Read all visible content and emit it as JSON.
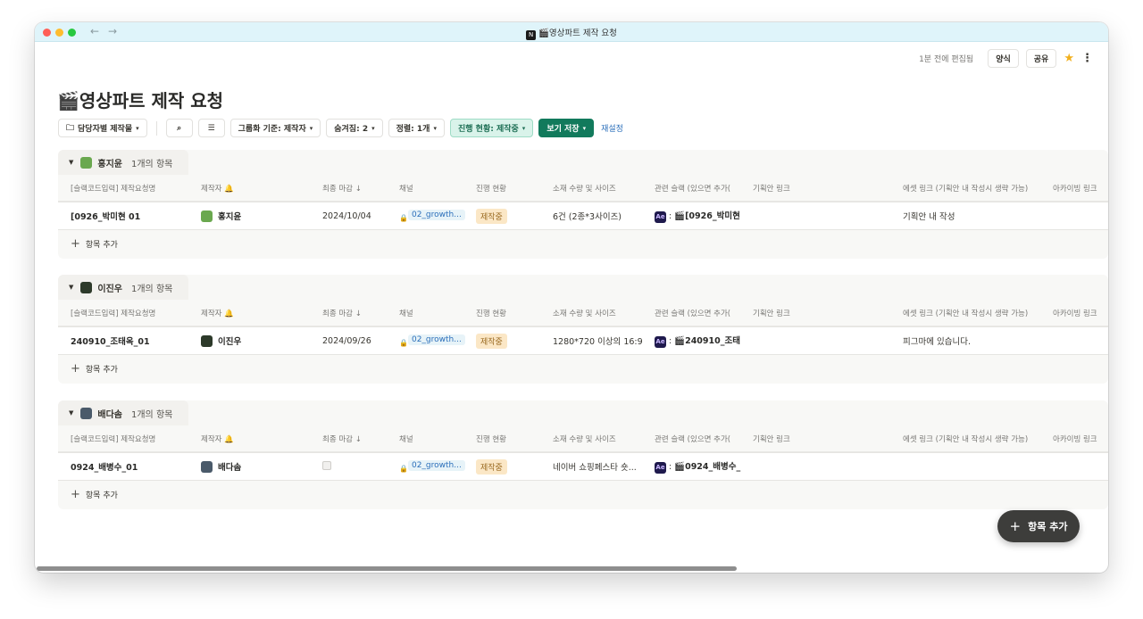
{
  "window": {
    "title": "🎬영상파트 제작 요청",
    "app_icon": "N"
  },
  "topbar": {
    "edited": "1분 전에 편집됨",
    "template_label": "양식",
    "share_label": "공유"
  },
  "page": {
    "title": "🎬영상파트 제작 요청"
  },
  "toolbar": {
    "view_label": "담당자별 제작물",
    "group_label": "그룹화 기준: 제작자",
    "hidden_label": "숨겨짐: 2",
    "sort_label": "정렬: 1개",
    "filter_label": "진행 현황: 제작중",
    "save_view_label": "보기 저장",
    "reset_label": "재설정"
  },
  "columns": [
    "[슬랙코드입력] 제작요청명",
    "제작자",
    "최종 마감",
    "채널",
    "진행 현황",
    "소재 수량 및 사이즈",
    "관련 슬랙 (있으면 추가(",
    "기획안 링크",
    "에셋 링크 (기획안 내 작성시 생략 가능)",
    "아카이빙 링크"
  ],
  "groups": [
    {
      "name": "홍지윤",
      "count": "1개의 항목",
      "avatar_color": "#6aa84f",
      "row": {
        "title": "[0926_박미현 01",
        "maker": "홍지윤",
        "deadline": "2024/10/04",
        "channel": "02_growth...",
        "status": "제작중",
        "size": "6건 (2종*3사이즈)",
        "slack": "[0926_박미현",
        "asset": "기획안 내 작성"
      },
      "add_label": "항목 추가"
    },
    {
      "name": "이진우",
      "count": "1개의 항목",
      "avatar_color": "#2d3a2a",
      "row": {
        "title": "240910_조태옥_01",
        "maker": "이진우",
        "deadline": "2024/09/26",
        "channel": "02_growth...",
        "status": "제작중",
        "size": "1280*720 이상의 16:9",
        "slack": "240910_조태",
        "asset": "피그마에 있습니다."
      },
      "add_label": "항목 추가"
    },
    {
      "name": "배다솜",
      "count": "1개의 항목",
      "avatar_color": "#4a5a6a",
      "row": {
        "title": "0924_배병수_01",
        "maker": "배다솜",
        "deadline": "",
        "channel": "02_growth...",
        "status": "제작중",
        "size": "네이버 쇼핑페스타 숏...",
        "slack": "0924_배병수_",
        "asset": ""
      },
      "add_label": "항목 추가"
    }
  ],
  "fab": {
    "label": "항목 추가"
  }
}
